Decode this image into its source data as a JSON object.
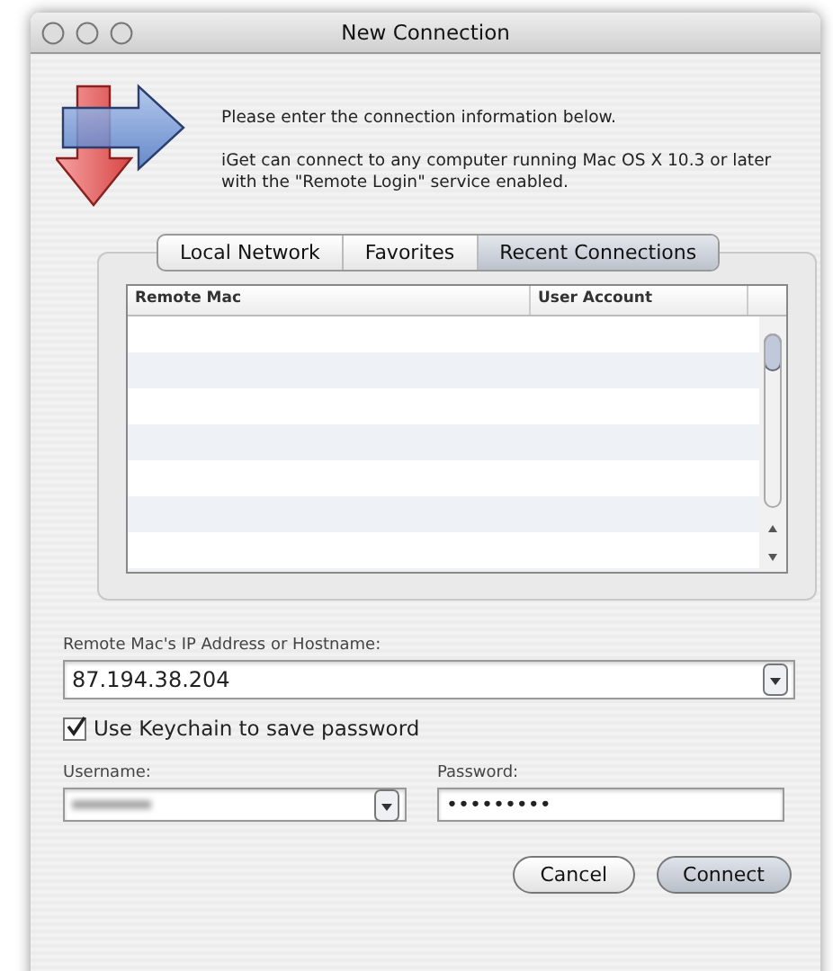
{
  "window": {
    "title": "New Connection"
  },
  "intro": [
    "Please enter the connection information below.",
    "iGet can connect to any computer running Mac OS X 10.3 or later with the \"Remote Login\" service enabled."
  ],
  "tabs": [
    {
      "label": "Local Network",
      "selected": false
    },
    {
      "label": "Favorites",
      "selected": false
    },
    {
      "label": "Recent Connections",
      "selected": true
    }
  ],
  "table": {
    "columns": [
      "Remote Mac",
      "User Account"
    ]
  },
  "host": {
    "label": "Remote Mac's IP Address or Hostname:",
    "value": "87.194.38.204"
  },
  "keychain": {
    "label": "Use Keychain to save password",
    "checked": true
  },
  "username": {
    "label": "Username:",
    "blurred": true
  },
  "password": {
    "label": "Password:",
    "value": "•••••••••"
  },
  "buttons": [
    {
      "label": "Cancel",
      "kind": "secondary"
    },
    {
      "label": "Connect",
      "kind": "default"
    }
  ]
}
